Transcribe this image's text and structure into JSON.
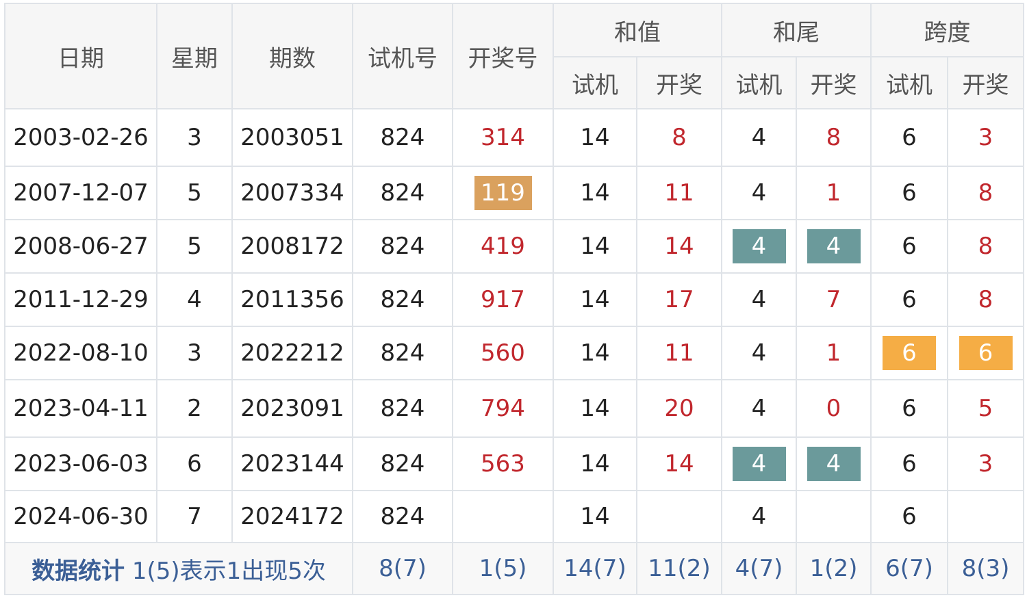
{
  "headers": {
    "date": "日期",
    "weekday": "星期",
    "issue": "期数",
    "test_no": "试机号",
    "draw_no": "开奖号",
    "sum_group": "和值",
    "tail_group": "和尾",
    "span_group": "跨度",
    "sub_test": "试机",
    "sub_draw": "开奖"
  },
  "rows": [
    {
      "date": "2003-02-26",
      "weekday": "3",
      "issue": "2003051",
      "test": "824",
      "draw": "314",
      "sum_test": "14",
      "sum_draw": "8",
      "tail_test": "4",
      "tail_draw": "8",
      "span_test": "6",
      "span_draw": "3"
    },
    {
      "date": "2007-12-07",
      "weekday": "5",
      "issue": "2007334",
      "test": "824",
      "draw": "119",
      "sum_test": "14",
      "sum_draw": "11",
      "tail_test": "4",
      "tail_draw": "1",
      "span_test": "6",
      "span_draw": "8"
    },
    {
      "date": "2008-06-27",
      "weekday": "5",
      "issue": "2008172",
      "test": "824",
      "draw": "419",
      "sum_test": "14",
      "sum_draw": "14",
      "tail_test": "4",
      "tail_draw": "4",
      "span_test": "6",
      "span_draw": "8"
    },
    {
      "date": "2011-12-29",
      "weekday": "4",
      "issue": "2011356",
      "test": "824",
      "draw": "917",
      "sum_test": "14",
      "sum_draw": "17",
      "tail_test": "4",
      "tail_draw": "7",
      "span_test": "6",
      "span_draw": "8"
    },
    {
      "date": "2022-08-10",
      "weekday": "3",
      "issue": "2022212",
      "test": "824",
      "draw": "560",
      "sum_test": "14",
      "sum_draw": "11",
      "tail_test": "4",
      "tail_draw": "1",
      "span_test": "6",
      "span_draw": "6"
    },
    {
      "date": "2023-04-11",
      "weekday": "2",
      "issue": "2023091",
      "test": "824",
      "draw": "794",
      "sum_test": "14",
      "sum_draw": "20",
      "tail_test": "4",
      "tail_draw": "0",
      "span_test": "6",
      "span_draw": "5"
    },
    {
      "date": "2023-06-03",
      "weekday": "6",
      "issue": "2023144",
      "test": "824",
      "draw": "563",
      "sum_test": "14",
      "sum_draw": "14",
      "tail_test": "4",
      "tail_draw": "4",
      "span_test": "6",
      "span_draw": "3"
    },
    {
      "date": "2024-06-30",
      "weekday": "7",
      "issue": "2024172",
      "test": "824",
      "draw": "",
      "sum_test": "14",
      "sum_draw": "",
      "tail_test": "4",
      "tail_draw": "",
      "span_test": "6",
      "span_draw": ""
    }
  ],
  "stats": {
    "title": "数据统计",
    "note": "1(5)表示1出现5次",
    "test": "8(7)",
    "draw": "1(5)",
    "sum_test": "14(7)",
    "sum_draw": "11(2)",
    "tail_test": "4(7)",
    "tail_draw": "1(2)",
    "span_test": "6(7)",
    "span_draw": "8(3)"
  },
  "colors": {
    "draw_text": "#c1272d",
    "stats_text": "#3b5f96",
    "highlight_teal": "#6b9a9b",
    "highlight_tan": "#daa15e",
    "highlight_orange": "#f5ad45",
    "border": "#dfe3e8",
    "header_bg": "#f6f6f6"
  }
}
